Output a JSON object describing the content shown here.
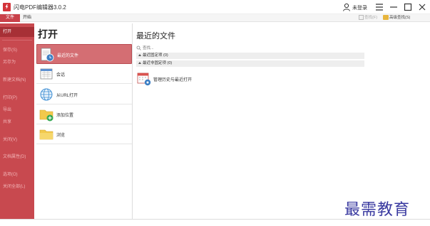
{
  "app": {
    "title": "闪电PDF编辑器3.0.2",
    "user_label": "未登录"
  },
  "tabs": {
    "file": "文件",
    "start": "开始"
  },
  "toolbar": {
    "find": "查找(F)",
    "advanced_find": "高级查找(S)"
  },
  "sidebar": {
    "items": [
      {
        "label": "打开",
        "active": true
      },
      {
        "label": "保存(S)"
      },
      {
        "label": "另存为"
      },
      {
        "label": "新建文档(N)"
      },
      {
        "label": "打印(P)"
      },
      {
        "label": "导出"
      },
      {
        "label": "共享"
      },
      {
        "label": "关闭(V)"
      },
      {
        "label": "文档属性(D)"
      },
      {
        "label": "选项(O)"
      },
      {
        "label": "关闭全部(L)"
      }
    ]
  },
  "open_panel": {
    "title": "打开",
    "items": [
      {
        "label": "最近的文件",
        "icon": "recent-files-icon",
        "active": true
      },
      {
        "label": "会话",
        "icon": "session-icon"
      },
      {
        "label": "从URL打开",
        "icon": "globe-icon"
      },
      {
        "label": "添加位置",
        "icon": "add-folder-icon"
      },
      {
        "label": "浏览",
        "icon": "folder-icon"
      }
    ]
  },
  "recent_panel": {
    "title": "最近的文件",
    "search_placeholder": "查找...",
    "groups": [
      {
        "label": "最近固定项 (0)"
      },
      {
        "label": "最近非固定项 (0)"
      }
    ],
    "manage_label": "管理历史与最近打开"
  },
  "watermark": "最需教育",
  "colors": {
    "accent": "#c8494f",
    "accent_dark": "#a73036",
    "active_item": "#d46e73"
  }
}
